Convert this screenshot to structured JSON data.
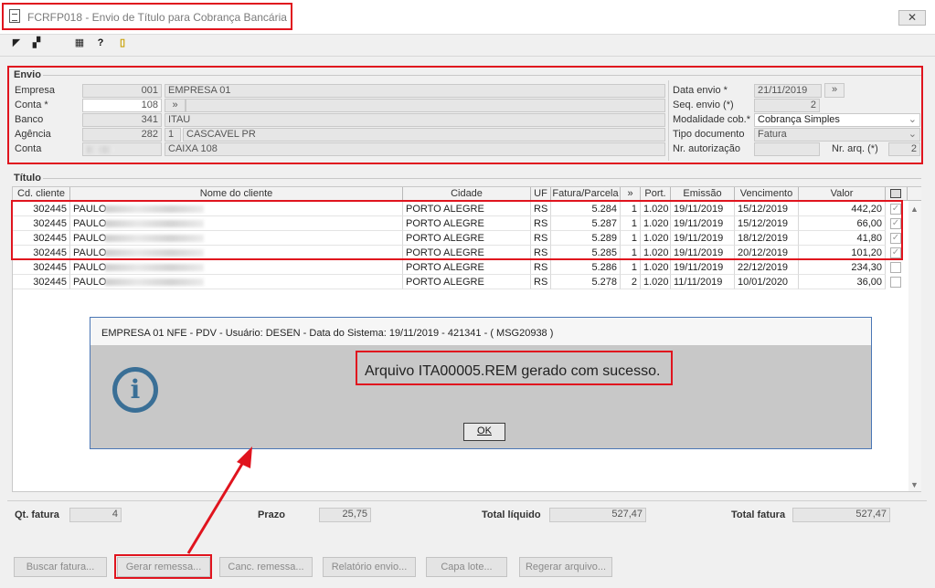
{
  "window": {
    "title": "FCRFP018 - Envio de Título para Cobrança Bancária",
    "close_symbol": "✕"
  },
  "toolbar": [
    {
      "name": "exit-icon",
      "glyph": "◤"
    },
    {
      "name": "copy-icon",
      "glyph": "▞"
    },
    {
      "name": "calc-icon",
      "glyph": "▦"
    },
    {
      "name": "help-icon",
      "glyph": "?"
    },
    {
      "name": "door-icon",
      "glyph": "▯"
    }
  ],
  "envio": {
    "title": "Envio",
    "empresa_label": "Empresa",
    "empresa_code": "001",
    "empresa_name": "EMPRESA 01",
    "conta_label": "Conta *",
    "conta_code": "108",
    "banco_label": "Banco",
    "banco_code": "341",
    "banco_name": "ITAU",
    "agencia_label": "Agência",
    "agencia_code": "282",
    "agencia_digit": "1",
    "agencia_name": "CASCAVEL PR",
    "conta2_label": "Conta",
    "conta2_name": "CAIXA 108",
    "data_envio_label": "Data envio *",
    "data_envio": "21/11/2019",
    "seq_envio_label": "Seq. envio (*)",
    "seq_envio": "2",
    "modalidade_label": "Modalidade cob.*",
    "modalidade": "Cobrança Simples",
    "tipo_doc_label": "Tipo documento",
    "tipo_doc": "Fatura",
    "nr_aut_label": "Nr. autorização",
    "nr_arq_label": "Nr. arq. (*)",
    "nr_arq": "2",
    "lookup_symbol": "»"
  },
  "titulo": {
    "title": "Título",
    "columns": [
      "Cd. cliente",
      "Nome do cliente",
      "Cidade",
      "UF",
      "Fatura/Parcela",
      "»",
      "Port.",
      "Emissão",
      "Vencimento",
      "Valor"
    ],
    "rows": [
      {
        "cd": "302445",
        "nome": "PAULO",
        "cidade": "PORTO ALEGRE",
        "uf": "RS",
        "fatura": "5.284",
        "parc": "1",
        "port": "1.020",
        "emissao": "19/11/2019",
        "venc": "15/12/2019",
        "valor": "442,20",
        "checked": "✓"
      },
      {
        "cd": "302445",
        "nome": "PAULO",
        "cidade": "PORTO ALEGRE",
        "uf": "RS",
        "fatura": "5.287",
        "parc": "1",
        "port": "1.020",
        "emissao": "19/11/2019",
        "venc": "15/12/2019",
        "valor": "66,00",
        "checked": "✓"
      },
      {
        "cd": "302445",
        "nome": "PAULO",
        "cidade": "PORTO ALEGRE",
        "uf": "RS",
        "fatura": "5.289",
        "parc": "1",
        "port": "1.020",
        "emissao": "19/11/2019",
        "venc": "18/12/2019",
        "valor": "41,80",
        "checked": "✓"
      },
      {
        "cd": "302445",
        "nome": "PAULO",
        "cidade": "PORTO ALEGRE",
        "uf": "RS",
        "fatura": "5.285",
        "parc": "1",
        "port": "1.020",
        "emissao": "19/11/2019",
        "venc": "20/12/2019",
        "valor": "101,20",
        "checked": "✓"
      },
      {
        "cd": "302445",
        "nome": "PAULO",
        "cidade": "PORTO ALEGRE",
        "uf": "RS",
        "fatura": "5.286",
        "parc": "1",
        "port": "1.020",
        "emissao": "19/11/2019",
        "venc": "22/12/2019",
        "valor": "234,30",
        "checked": ""
      },
      {
        "cd": "302445",
        "nome": "PAULO",
        "cidade": "PORTO ALEGRE",
        "uf": "RS",
        "fatura": "5.278",
        "parc": "2",
        "port": "1.020",
        "emissao": "11/11/2019",
        "venc": "10/01/2020",
        "valor": "36,00",
        "checked": ""
      }
    ]
  },
  "dialog": {
    "title": "EMPRESA 01 NFE - PDV - Usuário: DESEN - Data do Sistema: 19/11/2019 - 421341 - ( MSG20938 )",
    "message": "Arquivo ITA00005.REM gerado com sucesso.",
    "icon_glyph": "i",
    "ok": "OK"
  },
  "totals": {
    "qt_fatura_label": "Qt. fatura",
    "qt_fatura": "4",
    "prazo_label": "Prazo",
    "prazo": "25,75",
    "total_liquido_label": "Total líquido",
    "total_liquido": "527,47",
    "total_fatura_label": "Total fatura",
    "total_fatura": "527,47"
  },
  "buttons": {
    "buscar": "Buscar fatura...",
    "gerar": "Gerar remessa...",
    "canc": "Canc. remessa...",
    "relatorio": "Relatório envio...",
    "capa": "Capa lote...",
    "regerar": "Regerar arquivo..."
  },
  "colors": {
    "highlight": "#e0141e",
    "dialog_border": "#4a76b5",
    "info_icon": "#3a6f96"
  }
}
